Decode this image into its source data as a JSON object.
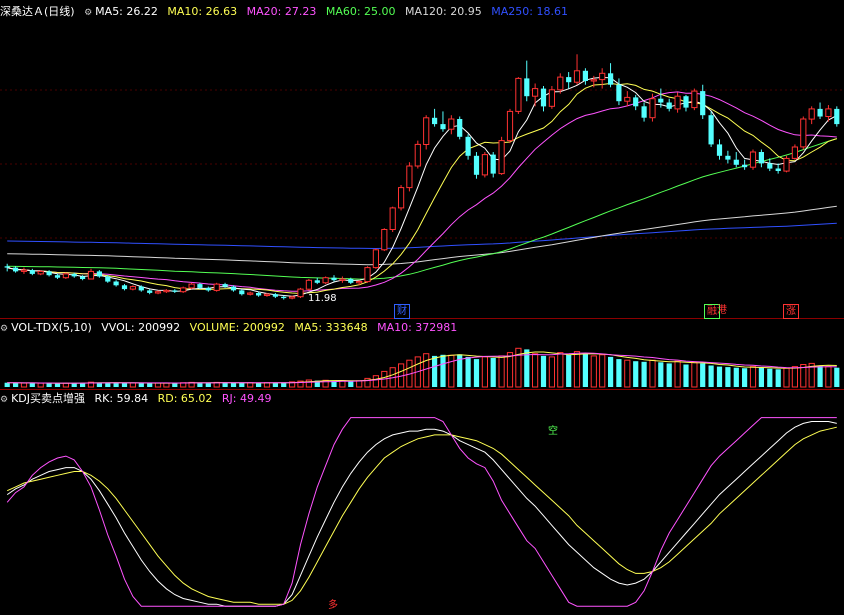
{
  "colors": {
    "up": "#ff3232",
    "down": "#54ffff",
    "bg": "#000000",
    "ma5": "#ffffff",
    "ma10": "#ffff54",
    "ma20": "#ff54ff",
    "ma60": "#54ff54",
    "ma120": "#d8d8d8",
    "ma250": "#3050ff",
    "sep": "#8b0000",
    "grid": "#4a0000"
  },
  "price_panel": {
    "stock": "深桑达Ａ",
    "period": "(日线)",
    "ma5": "MA5: 26.22",
    "ma10": "MA10: 26.63",
    "ma20": "MA20: 27.23",
    "ma60": "MA60: 25.00",
    "ma120": "MA120: 20.95",
    "ma250": "MA250: 18.61",
    "low_mark": "11.98",
    "tags": [
      {
        "text": "财",
        "color": "#3060ff"
      },
      {
        "text": "融",
        "color": "#ff3232"
      },
      {
        "text": "港",
        "color": "#ff3232"
      },
      {
        "text": "涨",
        "color": "#ff3232"
      }
    ]
  },
  "volume_panel": {
    "name": "VOL-TDX(5,10)",
    "vvol": "VVOL: 200992",
    "volume": "VOLUME: 200992",
    "ma5": "MA5: 333648",
    "ma10": "MA10: 372981"
  },
  "kdj_panel": {
    "name": "KDJ买卖点增强",
    "rk": "RK: 59.84",
    "rd": "RD: 65.02",
    "rj": "RJ: 49.49",
    "buy_mark": "多",
    "sell_mark": "空"
  },
  "chart_data": {
    "type": "candlestick",
    "price": {
      "ylim": [
        11.0,
        34.0
      ],
      "candles": [
        [
          14.6,
          14.8,
          14.2,
          14.5
        ],
        [
          14.5,
          14.6,
          14.1,
          14.2
        ],
        [
          14.2,
          14.5,
          14.0,
          14.3
        ],
        [
          14.3,
          14.4,
          13.9,
          14.0
        ],
        [
          14.0,
          14.3,
          13.9,
          14.2
        ],
        [
          14.2,
          14.3,
          13.8,
          13.9
        ],
        [
          13.9,
          14.0,
          13.6,
          13.7
        ],
        [
          13.7,
          14.1,
          13.6,
          14.0
        ],
        [
          14.0,
          14.1,
          13.7,
          13.8
        ],
        [
          13.8,
          13.9,
          13.5,
          13.6
        ],
        [
          13.6,
          14.4,
          13.6,
          14.2
        ],
        [
          14.2,
          14.3,
          13.7,
          13.8
        ],
        [
          13.8,
          13.9,
          13.3,
          13.4
        ],
        [
          13.4,
          13.5,
          13.0,
          13.1
        ],
        [
          13.1,
          13.2,
          12.7,
          12.8
        ],
        [
          12.8,
          13.1,
          12.7,
          13.0
        ],
        [
          13.0,
          13.1,
          12.6,
          12.7
        ],
        [
          12.7,
          12.8,
          12.4,
          12.5
        ],
        [
          12.5,
          12.7,
          12.4,
          12.6
        ],
        [
          12.6,
          12.8,
          12.5,
          12.7
        ],
        [
          12.7,
          12.8,
          12.5,
          12.6
        ],
        [
          12.6,
          13.0,
          12.5,
          12.9
        ],
        [
          12.9,
          13.3,
          12.8,
          13.2
        ],
        [
          13.2,
          13.3,
          12.8,
          12.9
        ],
        [
          12.9,
          13.0,
          12.6,
          12.7
        ],
        [
          12.7,
          13.3,
          12.6,
          13.2
        ],
        [
          13.2,
          13.3,
          12.9,
          13.0
        ],
        [
          13.0,
          13.1,
          12.6,
          12.7
        ],
        [
          12.7,
          12.8,
          12.3,
          12.4
        ],
        [
          12.4,
          12.6,
          12.3,
          12.5
        ],
        [
          12.5,
          12.6,
          12.2,
          12.3
        ],
        [
          12.3,
          12.5,
          12.2,
          12.4
        ],
        [
          12.4,
          12.5,
          12.1,
          12.2
        ],
        [
          12.2,
          12.3,
          11.98,
          12.1
        ],
        [
          12.1,
          12.3,
          12.0,
          12.2
        ],
        [
          12.2,
          12.9,
          12.1,
          12.8
        ],
        [
          12.8,
          13.6,
          12.7,
          13.5
        ],
        [
          13.5,
          13.7,
          13.2,
          13.3
        ],
        [
          13.3,
          13.8,
          13.2,
          13.7
        ],
        [
          13.7,
          13.9,
          13.4,
          13.5
        ],
        [
          13.5,
          13.8,
          13.3,
          13.6
        ],
        [
          13.6,
          13.7,
          13.2,
          13.3
        ],
        [
          13.3,
          13.5,
          13.1,
          13.4
        ],
        [
          13.4,
          14.6,
          13.3,
          14.5
        ],
        [
          14.5,
          16.0,
          14.4,
          15.9
        ],
        [
          15.9,
          17.6,
          15.8,
          17.5
        ],
        [
          17.5,
          19.3,
          17.3,
          19.2
        ],
        [
          19.2,
          21.0,
          19.0,
          20.8
        ],
        [
          20.8,
          22.8,
          20.5,
          22.5
        ],
        [
          22.5,
          24.5,
          22.3,
          24.2
        ],
        [
          24.2,
          26.5,
          23.8,
          26.3
        ],
        [
          26.3,
          27.0,
          25.6,
          25.8
        ],
        [
          25.8,
          26.8,
          25.2,
          25.4
        ],
        [
          25.4,
          26.5,
          25.0,
          26.2
        ],
        [
          26.2,
          26.4,
          24.6,
          24.8
        ],
        [
          24.8,
          25.0,
          23.0,
          23.3
        ],
        [
          23.3,
          23.6,
          21.5,
          21.8
        ],
        [
          21.8,
          23.6,
          21.6,
          23.4
        ],
        [
          23.4,
          23.6,
          21.6,
          21.9
        ],
        [
          21.9,
          24.8,
          21.8,
          24.5
        ],
        [
          24.5,
          27.0,
          24.3,
          26.8
        ],
        [
          26.8,
          29.5,
          26.6,
          29.4
        ],
        [
          29.4,
          30.8,
          27.6,
          28.0
        ],
        [
          28.0,
          29.0,
          27.2,
          28.6
        ],
        [
          28.6,
          28.8,
          26.8,
          27.2
        ],
        [
          27.2,
          28.8,
          27.0,
          28.5
        ],
        [
          28.5,
          29.8,
          28.2,
          29.5
        ],
        [
          29.5,
          29.9,
          28.6,
          29.1
        ],
        [
          29.1,
          31.3,
          28.9,
          30.0
        ],
        [
          30.0,
          30.2,
          28.9,
          29.2
        ],
        [
          29.2,
          29.6,
          28.7,
          29.3
        ],
        [
          29.3,
          30.2,
          28.6,
          29.8
        ],
        [
          29.8,
          30.6,
          28.7,
          28.9
        ],
        [
          28.9,
          29.4,
          27.3,
          27.6
        ],
        [
          27.6,
          28.4,
          27.2,
          27.9
        ],
        [
          27.9,
          28.1,
          26.9,
          27.2
        ],
        [
          27.2,
          27.5,
          26.0,
          26.3
        ],
        [
          26.3,
          28.2,
          26.0,
          27.8
        ],
        [
          27.8,
          28.6,
          27.1,
          27.5
        ],
        [
          27.5,
          27.8,
          26.8,
          27.0
        ],
        [
          27.0,
          28.3,
          26.7,
          28.0
        ],
        [
          28.0,
          28.1,
          26.8,
          27.1
        ],
        [
          27.1,
          28.6,
          26.9,
          28.4
        ],
        [
          28.4,
          28.9,
          26.2,
          26.5
        ],
        [
          26.5,
          26.8,
          24.0,
          24.2
        ],
        [
          24.2,
          24.6,
          23.0,
          23.3
        ],
        [
          23.3,
          23.7,
          22.7,
          23.0
        ],
        [
          23.0,
          23.6,
          22.4,
          22.6
        ],
        [
          22.6,
          23.0,
          22.2,
          22.4
        ],
        [
          22.4,
          23.8,
          22.2,
          23.6
        ],
        [
          23.6,
          23.8,
          22.4,
          22.7
        ],
        [
          22.7,
          23.1,
          22.1,
          22.3
        ],
        [
          22.3,
          22.7,
          21.9,
          22.1
        ],
        [
          22.1,
          23.3,
          22.0,
          23.1
        ],
        [
          23.1,
          24.2,
          23.0,
          24.0
        ],
        [
          24.0,
          26.4,
          23.8,
          26.2
        ],
        [
          26.2,
          27.2,
          25.8,
          27.0
        ],
        [
          27.0,
          27.5,
          26.2,
          26.4
        ],
        [
          26.4,
          27.3,
          26.0,
          27.0
        ],
        [
          27.0,
          27.2,
          25.6,
          25.8
        ]
      ]
    },
    "volume": {
      "ylim": [
        0,
        950000
      ],
      "values": [
        80000,
        78000,
        72000,
        75000,
        70000,
        68000,
        72000,
        70000,
        74000,
        76000,
        90000,
        82000,
        80000,
        78000,
        75000,
        74000,
        72000,
        70000,
        75000,
        72000,
        74000,
        80000,
        86000,
        80000,
        78000,
        85000,
        80000,
        76000,
        74000,
        78000,
        76000,
        80000,
        80000,
        82000,
        95000,
        110000,
        130000,
        120000,
        125000,
        115000,
        118000,
        112000,
        115000,
        160000,
        210000,
        290000,
        360000,
        430000,
        500000,
        560000,
        620000,
        580000,
        600000,
        590000,
        610000,
        560000,
        520000,
        560000,
        540000,
        580000,
        640000,
        720000,
        700000,
        620000,
        580000,
        560000,
        640000,
        600000,
        660000,
        620000,
        580000,
        600000,
        560000,
        520000,
        500000,
        480000,
        470000,
        500000,
        460000,
        440000,
        480000,
        420000,
        460000,
        440000,
        400000,
        380000,
        370000,
        360000,
        350000,
        380000,
        360000,
        340000,
        330000,
        350000,
        380000,
        420000,
        440000,
        400000,
        380000,
        360000
      ]
    },
    "kdj": {
      "ylim": [
        0,
        105
      ],
      "series": [
        {
          "name": "RK",
          "values": [
            60,
            63,
            65,
            68,
            70,
            72,
            73,
            74,
            74,
            72,
            68,
            62,
            55,
            48,
            40,
            33,
            26,
            20,
            15,
            11,
            8,
            6,
            5,
            4,
            3,
            3,
            2,
            2,
            2,
            2,
            2,
            2,
            2,
            3,
            8,
            18,
            28,
            38,
            47,
            56,
            64,
            71,
            77,
            82,
            86,
            89,
            91,
            92,
            93,
            93,
            94,
            94,
            93,
            91,
            88,
            86,
            84,
            82,
            78,
            73,
            68,
            63,
            58,
            54,
            49,
            44,
            39,
            34,
            30,
            26,
            22,
            19,
            16,
            14,
            13,
            14,
            16,
            20,
            25,
            30,
            35,
            40,
            45,
            50,
            55,
            60,
            64,
            68,
            72,
            76,
            80,
            84,
            88,
            92,
            95,
            97,
            98,
            98,
            98,
            97
          ]
        },
        {
          "name": "RD",
          "values": [
            62,
            64,
            66,
            67,
            68,
            69,
            70,
            71,
            72,
            72,
            70,
            67,
            63,
            58,
            52,
            46,
            40,
            34,
            28,
            23,
            18,
            14,
            11,
            9,
            7,
            6,
            5,
            4,
            4,
            4,
            3,
            3,
            3,
            3,
            5,
            10,
            17,
            25,
            33,
            41,
            49,
            56,
            63,
            69,
            74,
            79,
            82,
            85,
            87,
            89,
            90,
            91,
            91,
            91,
            90,
            89,
            88,
            86,
            84,
            81,
            77,
            73,
            69,
            65,
            61,
            57,
            53,
            49,
            44,
            40,
            36,
            32,
            28,
            24,
            21,
            19,
            19,
            20,
            22,
            25,
            29,
            33,
            37,
            41,
            45,
            50,
            54,
            58,
            62,
            66,
            70,
            74,
            78,
            82,
            86,
            89,
            91,
            93,
            94,
            95
          ]
        },
        {
          "name": "RJ",
          "values": [
            56,
            61,
            64,
            70,
            74,
            77,
            79,
            80,
            78,
            72,
            64,
            52,
            39,
            28,
            16,
            7,
            2,
            2,
            2,
            2,
            2,
            2,
            2,
            2,
            2,
            2,
            2,
            2,
            2,
            2,
            2,
            2,
            2,
            3,
            14,
            34,
            50,
            64,
            75,
            86,
            94,
            100,
            100,
            100,
            100,
            100,
            100,
            100,
            100,
            100,
            100,
            100,
            98,
            91,
            84,
            79,
            76,
            74,
            67,
            57,
            50,
            43,
            36,
            32,
            25,
            18,
            11,
            4,
            2,
            2,
            2,
            2,
            2,
            2,
            2,
            4,
            10,
            20,
            31,
            40,
            47,
            54,
            61,
            68,
            75,
            80,
            84,
            88,
            92,
            96,
            100,
            100,
            100,
            100,
            100,
            100,
            100,
            100,
            100,
            100
          ]
        }
      ]
    }
  }
}
